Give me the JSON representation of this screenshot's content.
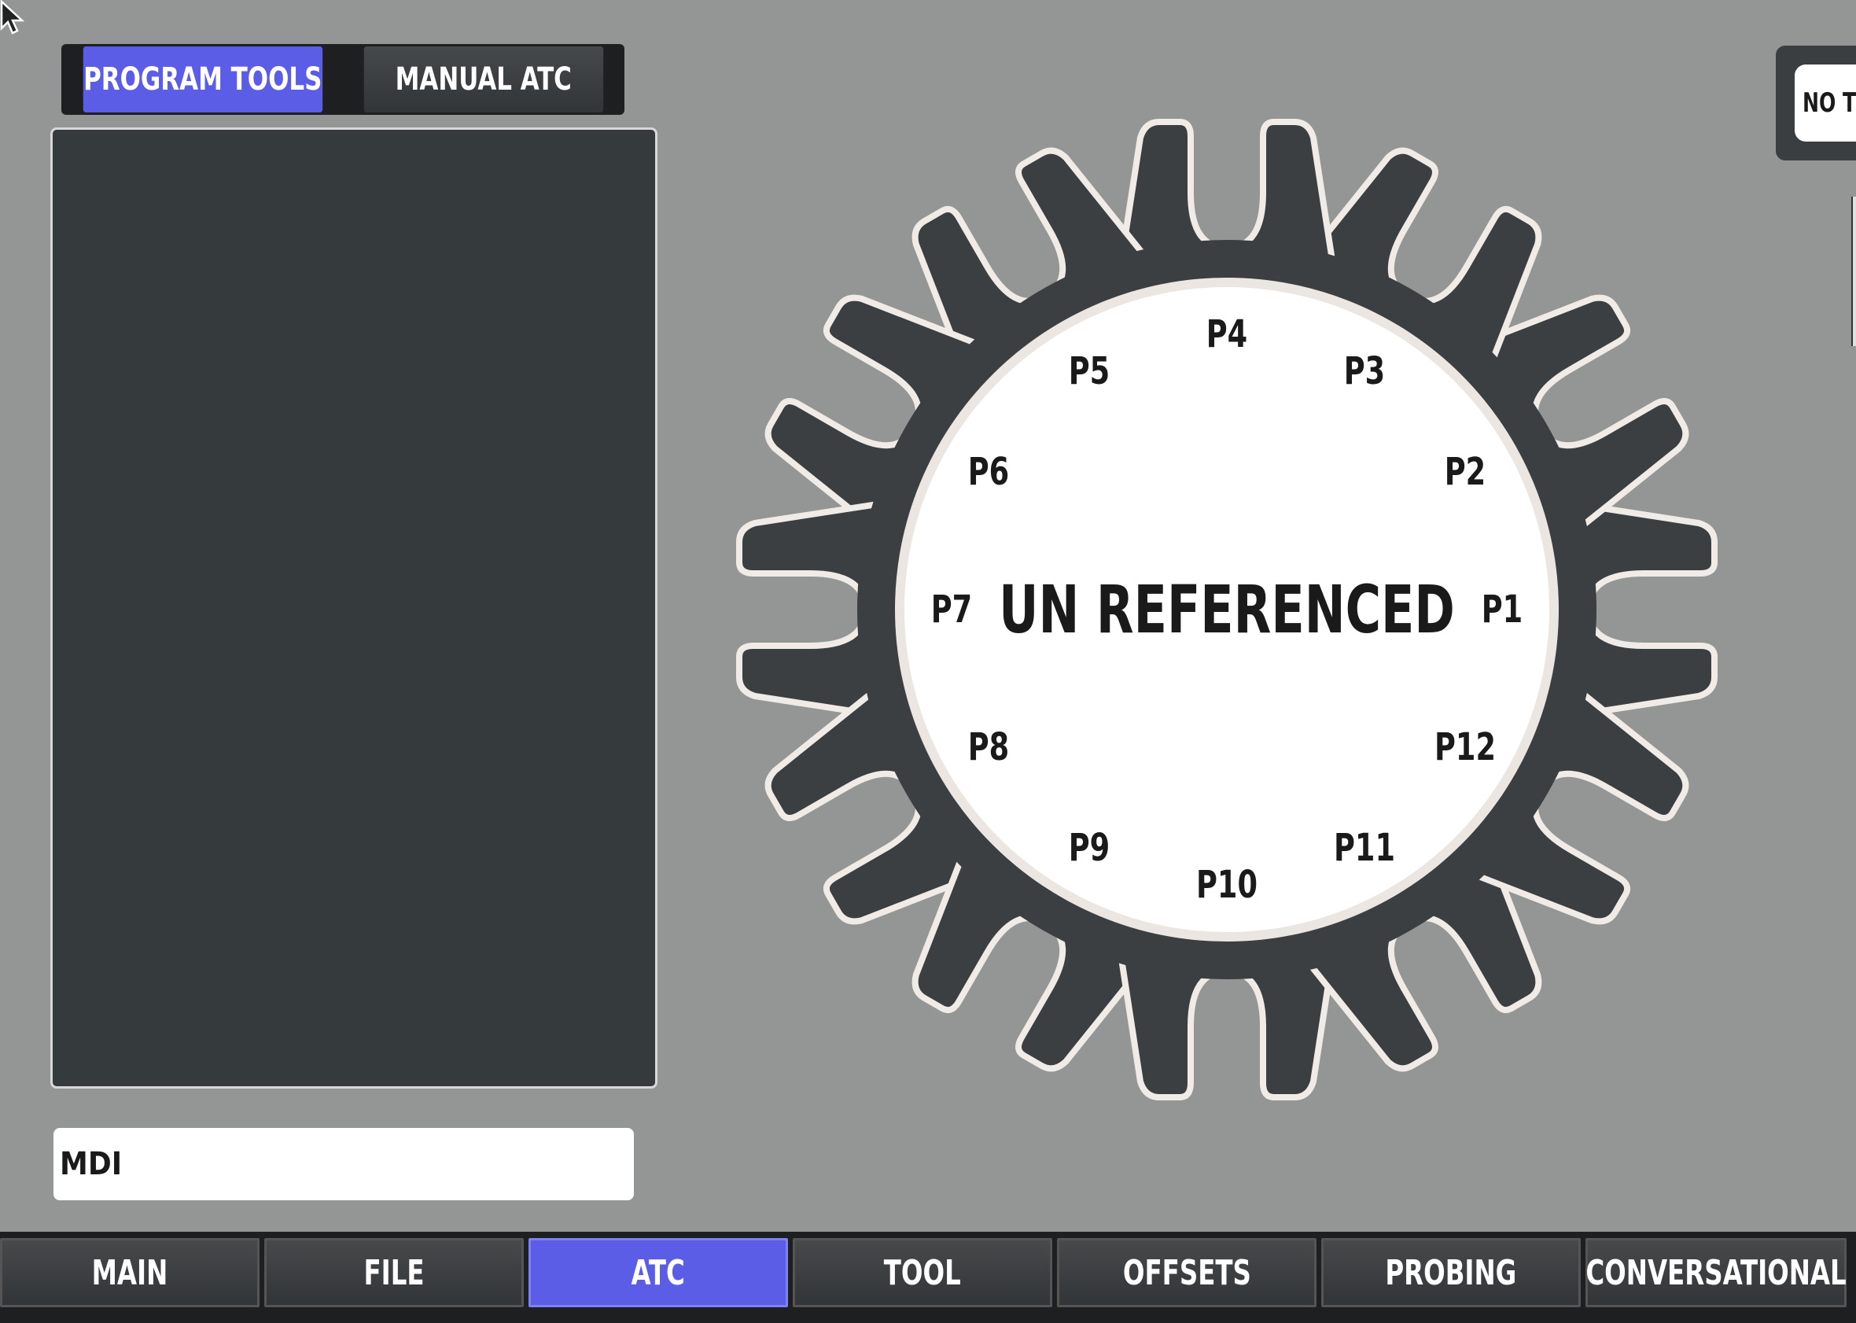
{
  "top_tabs": [
    {
      "label": "PROGRAM TOOLS",
      "active": true
    },
    {
      "label": "MANUAL ATC",
      "active": false
    }
  ],
  "mdi": {
    "value": "MDI"
  },
  "carousel": {
    "status": "UN REFERENCED",
    "pockets": [
      "P1",
      "P2",
      "P3",
      "P4",
      "P5",
      "P6",
      "P7",
      "P8",
      "P9",
      "P10",
      "P11",
      "P12"
    ]
  },
  "tool_status": {
    "text": "NO TOOL"
  },
  "bottom_tabs": [
    {
      "label": "MAIN",
      "active": false
    },
    {
      "label": "FILE",
      "active": false
    },
    {
      "label": "ATC",
      "active": true
    },
    {
      "label": "TOOL",
      "active": false
    },
    {
      "label": "OFFSETS",
      "active": false
    },
    {
      "label": "PROBING",
      "active": false
    },
    {
      "label": "CONVERSATIONAL",
      "active": false
    }
  ],
  "colors": {
    "accent": "#5b5de6",
    "background": "#949695",
    "panel": "#353a3d",
    "dark": "#1d1f20"
  },
  "icons": {
    "cursor": "mouse-pointer-icon"
  }
}
